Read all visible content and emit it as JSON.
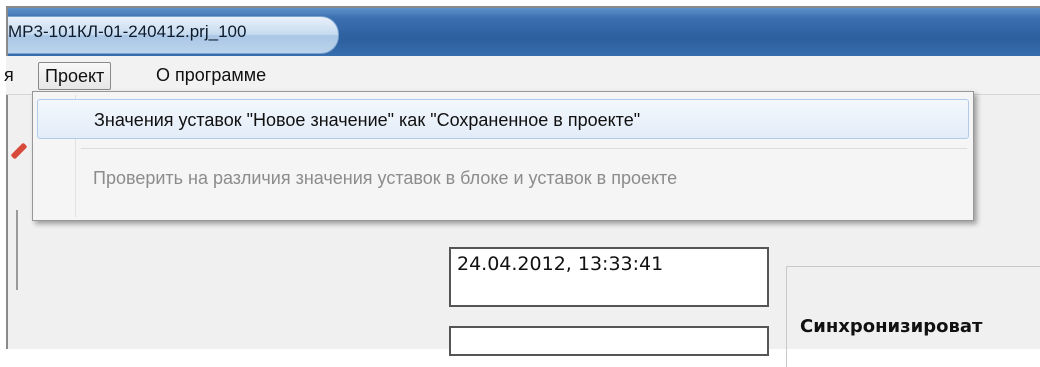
{
  "window": {
    "title": "МР3-101КЛ-01-240412.prj_100"
  },
  "menubar": {
    "partial_item": "я",
    "project": "Проект",
    "about": "О программе"
  },
  "dropdown": {
    "items": [
      {
        "label": "Значения уставок \"Новое значение\" как \"Сохраненное в проекте\"",
        "state": "highlighted"
      },
      {
        "label": "Проверить на различия значения уставок в блоке и уставок в проекте",
        "state": "disabled"
      }
    ]
  },
  "content": {
    "timestamp": "24.04.2012, 13:33:41",
    "sync_label": "Синхронизироват"
  },
  "colors": {
    "titlebar": "#2c5f9e",
    "highlight": "#e2ecf8",
    "disabled_text": "#8c8c8c"
  }
}
